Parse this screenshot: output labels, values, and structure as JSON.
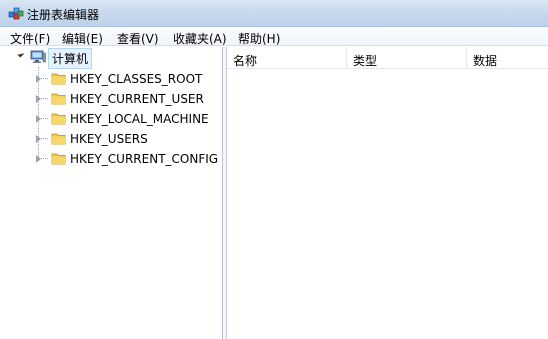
{
  "window": {
    "title": "注册表编辑器",
    "icon": "registry-editor-icon"
  },
  "menu": [
    {
      "label": "文件(F)"
    },
    {
      "label": "编辑(E)"
    },
    {
      "label": "查看(V)"
    },
    {
      "label": "收藏夹(A)"
    },
    {
      "label": "帮助(H)"
    }
  ],
  "tree": {
    "root": {
      "label": "计算机",
      "icon": "computer-icon",
      "expanded": true
    },
    "items": [
      {
        "label": "HKEY_CLASSES_ROOT",
        "icon": "folder-icon"
      },
      {
        "label": "HKEY_CURRENT_USER",
        "icon": "folder-icon"
      },
      {
        "label": "HKEY_LOCAL_MACHINE",
        "icon": "folder-icon"
      },
      {
        "label": "HKEY_USERS",
        "icon": "folder-icon"
      },
      {
        "label": "HKEY_CURRENT_CONFIG",
        "icon": "folder-icon"
      }
    ]
  },
  "list": {
    "columns": [
      {
        "label": "名称"
      },
      {
        "label": "类型"
      },
      {
        "label": "数据"
      }
    ]
  },
  "colors": {
    "titlebar": "#c8daee",
    "selection": "#e5f1fb",
    "folder": "#f2c94c"
  }
}
